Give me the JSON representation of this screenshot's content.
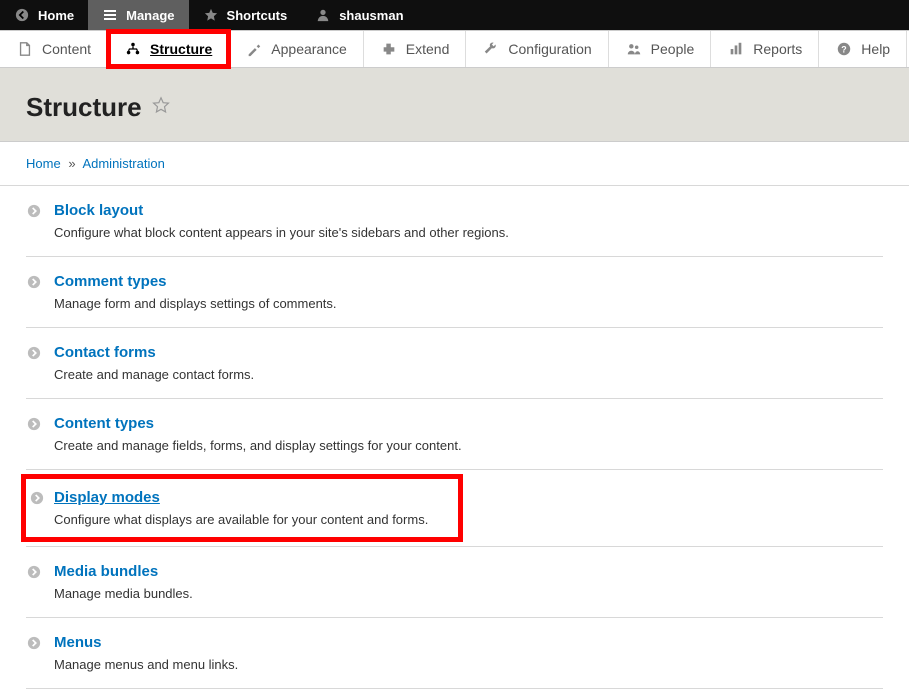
{
  "toolbar": {
    "home": "Home",
    "manage": "Manage",
    "shortcuts": "Shortcuts",
    "user": "shausman"
  },
  "tabs": {
    "content": "Content",
    "structure": "Structure",
    "appearance": "Appearance",
    "extend": "Extend",
    "configuration": "Configuration",
    "people": "People",
    "reports": "Reports",
    "help": "Help"
  },
  "page": {
    "title": "Structure"
  },
  "breadcrumb": {
    "home": "Home",
    "sep": "»",
    "admin": "Administration"
  },
  "items": [
    {
      "title": "Block layout",
      "desc": "Configure what block content appears in your site's sidebars and other regions."
    },
    {
      "title": "Comment types",
      "desc": "Manage form and displays settings of comments."
    },
    {
      "title": "Contact forms",
      "desc": "Create and manage contact forms."
    },
    {
      "title": "Content types",
      "desc": "Create and manage fields, forms, and display settings for your content."
    },
    {
      "title": "Display modes",
      "desc": "Configure what displays are available for your content and forms."
    },
    {
      "title": "Media bundles",
      "desc": "Manage media bundles."
    },
    {
      "title": "Menus",
      "desc": "Manage menus and menu links."
    }
  ]
}
